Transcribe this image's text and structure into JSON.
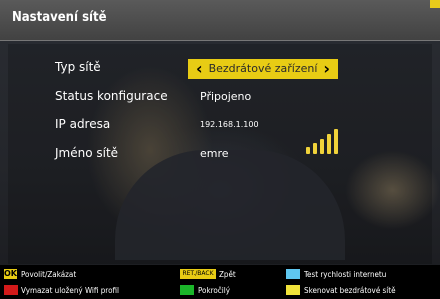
{
  "header": {
    "title": "Nastavení sítě"
  },
  "settings": {
    "network_type_label": "Typ sítě",
    "network_type_value": "Bezdrátové zařízení",
    "config_status_label": "Status konfigurace",
    "config_status_value": "Připojeno",
    "ip_label": "IP adresa",
    "ip_value": "192.168.1.100",
    "network_name_label": "Jméno sítě",
    "network_name_value": "emre",
    "signal_strength": 5
  },
  "footer": {
    "ok_key": "OK",
    "ok_label": "Povolit/Zakázat",
    "back_key": "RET./BACK",
    "back_label": "Zpět",
    "blue_label": "Test rychlosti internetu",
    "red_label": "Vymazat uložený Wifi profil",
    "green_label": "Pokročilý",
    "yellow_label": "Skenovat bezdrátové sítě"
  },
  "colors": {
    "accent_yellow": "#e8cc14",
    "red": "#d31a1a",
    "green": "#1bb52a",
    "blue": "#5fc7f0",
    "yellow": "#f0e23a"
  }
}
